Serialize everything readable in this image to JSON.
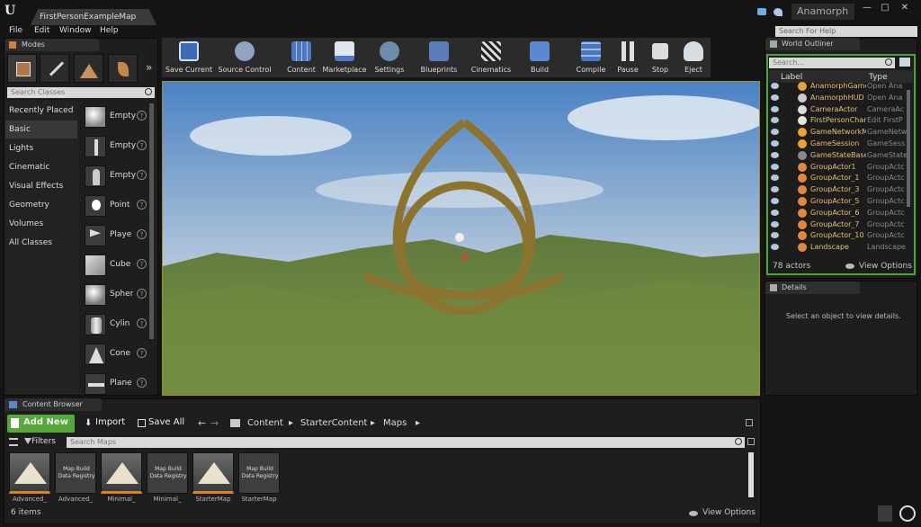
{
  "window": {
    "tab": "FirstPersonExampleMap",
    "project": "Anamorph"
  },
  "menu": [
    "File",
    "Edit",
    "Window",
    "Help"
  ],
  "help_search": "Search For Help",
  "modes": {
    "tab": "Modes",
    "search": "Search Classes",
    "categories": [
      "Recently Placed",
      "Basic",
      "Lights",
      "Cinematic",
      "Visual Effects",
      "Geometry",
      "Volumes",
      "All Classes"
    ],
    "items": [
      "Empty",
      "Empty",
      "Empty",
      "Point",
      "Playe",
      "Cube",
      "Spher",
      "Cylin",
      "Cone",
      "Plane"
    ]
  },
  "toolbar": [
    "Save Current",
    "Source Control",
    "Content",
    "Marketplace",
    "Settings",
    "Blueprints",
    "Cinematics",
    "Build",
    "Compile",
    "Pause",
    "Stop",
    "Eject"
  ],
  "outliner": {
    "tab": "World Outliner",
    "search": "Search...",
    "col_label": "Label",
    "col_type": "Type",
    "rows": [
      {
        "name": "AnamorphGame",
        "type": "Open Ana"
      },
      {
        "name": "AnamorphHUD",
        "type": "Open Ana"
      },
      {
        "name": "CameraActor",
        "type": "CameraAc"
      },
      {
        "name": "FirstPersonChar",
        "type": "Edit FirstP"
      },
      {
        "name": "GameNetworkMa",
        "type": "GameNetw"
      },
      {
        "name": "GameSession",
        "type": "GameSess"
      },
      {
        "name": "GameStateBase",
        "type": "GameState"
      },
      {
        "name": "GroupActor1",
        "type": "GroupActc"
      },
      {
        "name": "GroupActor_1",
        "type": "GroupActc"
      },
      {
        "name": "GroupActor_3",
        "type": "GroupActc"
      },
      {
        "name": "GroupActor_5",
        "type": "GroupActc"
      },
      {
        "name": "GroupActor_6",
        "type": "GroupActc"
      },
      {
        "name": "GroupActor_7",
        "type": "GroupActc"
      },
      {
        "name": "GroupActor_10",
        "type": "GroupActc"
      },
      {
        "name": "Landscape",
        "type": "Landscape"
      }
    ],
    "count": "78 actors",
    "view_options": "View Options"
  },
  "details": {
    "tab": "Details",
    "empty": "Select an object to view details."
  },
  "content_browser": {
    "tab": "Content Browser",
    "add_new": "Add New",
    "import": "Import",
    "save_all": "Save All",
    "path": [
      "Content",
      "StarterContent",
      "Maps"
    ],
    "filters": "Filters",
    "search": "Search Maps",
    "assets": [
      {
        "label": "Advanced_",
        "kind": "map"
      },
      {
        "label": "Advanced_",
        "kind": "registry",
        "tag": "Map Build Data Registry"
      },
      {
        "label": "Minimal_",
        "kind": "map"
      },
      {
        "label": "Minimal_",
        "kind": "registry",
        "tag": "Map Build Data Registry"
      },
      {
        "label": "StarterMap",
        "kind": "map"
      },
      {
        "label": "StarterMap",
        "kind": "registry",
        "tag": "Map Build Data Registry"
      }
    ],
    "count": "6 items",
    "view_options": "View Options"
  }
}
